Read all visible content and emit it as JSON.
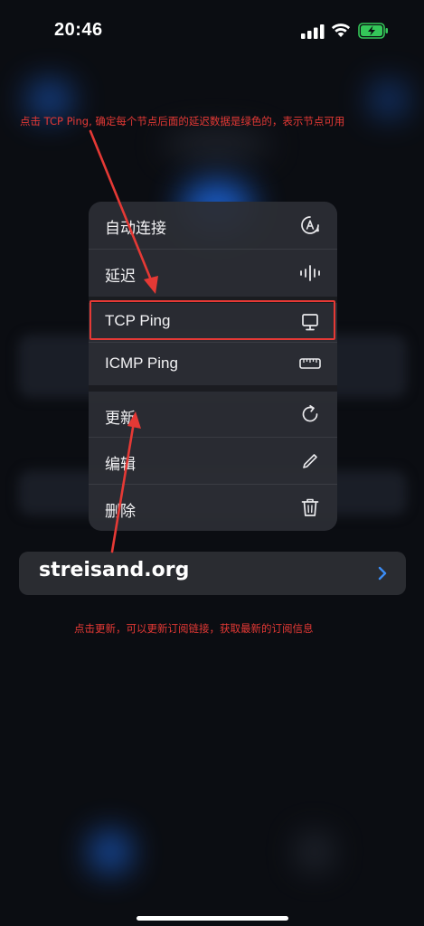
{
  "status_bar": {
    "time": "20:46"
  },
  "menu": {
    "items": [
      {
        "label": "自动连接",
        "icon": "auto-connect-icon"
      },
      {
        "label": "延迟",
        "icon": "latency-bars-icon"
      },
      {
        "label": "TCP Ping",
        "icon": "monitor-icon"
      },
      {
        "label": "ICMP Ping",
        "icon": "ruler-icon"
      },
      {
        "label": "更新",
        "icon": "refresh-icon"
      },
      {
        "label": "编辑",
        "icon": "pencil-icon"
      },
      {
        "label": "删除",
        "icon": "trash-icon"
      }
    ]
  },
  "subscription": {
    "name": "streisand.org",
    "icon": "chevron-right-icon"
  },
  "annotations": {
    "top": "点击 TCP Ping, 确定每个节点后面的延迟数据是绿色的，表示节点可用",
    "bottom": "点击更新，可以更新订阅链接，获取最新的订阅信息"
  },
  "colors": {
    "annotation": "#e53935",
    "accent": "#1c63d6",
    "chevron": "#3b8cf5",
    "battery": "#34c759"
  }
}
